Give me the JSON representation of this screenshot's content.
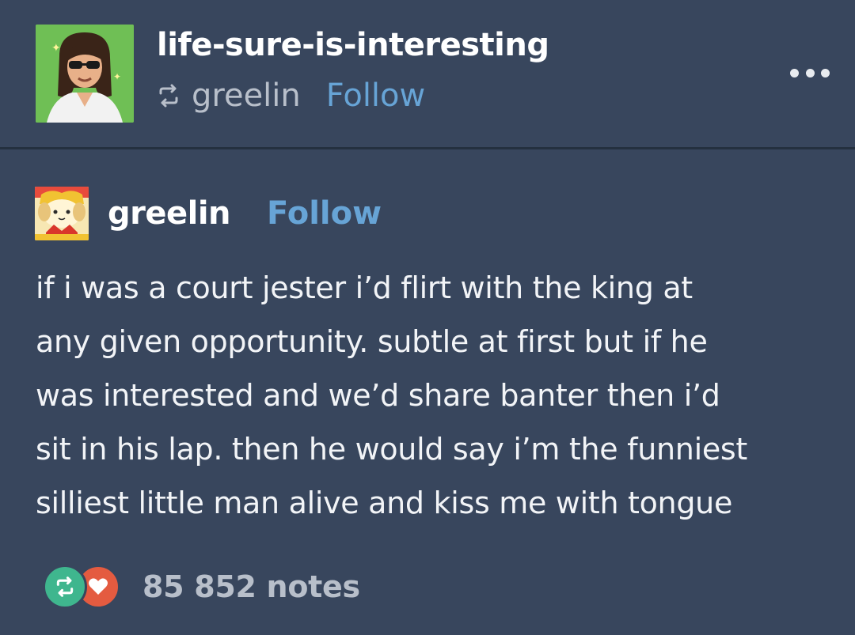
{
  "reblog_header": {
    "username": "life-sure-is-interesting",
    "source_username": "greelin",
    "follow_label": "Follow",
    "reblog_icon": "reblog-icon",
    "menu_icon": "more-icon"
  },
  "post": {
    "author": "greelin",
    "follow_label": "Follow",
    "body_lines": [
      "if i was a court jester i’d flirt with the king at",
      "any given opportunity. subtle at first but if he",
      "was interested and we’d share banter then i’d",
      "sit in his lap. then he would say i’m the funniest",
      "silliest little man alive and kiss me with tongue"
    ]
  },
  "footer": {
    "notes": "85 852 notes",
    "reblog_badge_color": "#3fb68e",
    "like_badge_color": "#e45b40"
  },
  "colors": {
    "background": "#38465d",
    "link": "#67a4d6",
    "muted": "#b8bfca"
  }
}
